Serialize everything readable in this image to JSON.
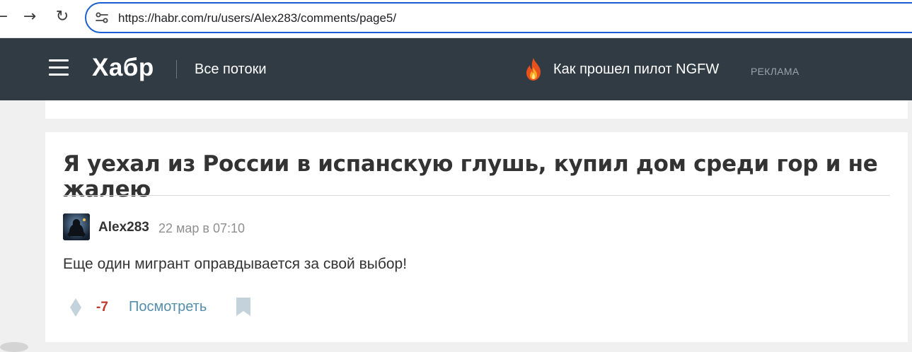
{
  "browser": {
    "url": "https://habr.com/ru/users/Alex283/comments/page5/",
    "back_icon": "back-arrow-icon",
    "forward_icon": "forward-arrow-icon",
    "reload_icon": "reload-icon"
  },
  "header": {
    "logo": "Хабр",
    "flows_link": "Все потоки",
    "promo_text": "Как прошел пилот NGFW",
    "promo_label": "РЕКЛАМА",
    "background_color": "#303b44"
  },
  "comment": {
    "post_title": "Я уехал из России в испанскую глушь, купил дом среди гор и не жалею",
    "author": "Alex283",
    "date": "22 мар в 07:10",
    "text": "Еще один мигрант оправдывается за свой выбор!",
    "score": "-7",
    "view_link": "Посмотреть",
    "score_color": "#c0392b",
    "link_color": "#548eaa"
  }
}
